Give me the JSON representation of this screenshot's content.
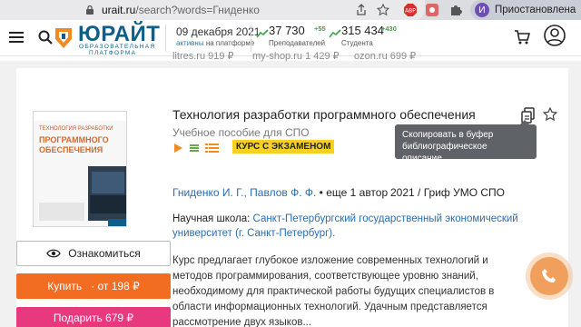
{
  "browser": {
    "url_host": "urait.ru",
    "url_path": "/search?words=Гниденко",
    "profile_initial": "И",
    "profile_label": "Приостановлена"
  },
  "header": {
    "logo_title": "ЮРАЙТ",
    "logo_subtitle_1": "ОБРАЗОВАТЕЛЬНАЯ",
    "logo_subtitle_2": "ПЛАТФОРМА",
    "date": "09 декабря 2021",
    "date_sub_active": "активны",
    "date_sub_rest": " на платформе",
    "teachers_count": "37 730",
    "teachers_plus": "+55",
    "teachers_label": "Преподавателей",
    "students_count": "315 434",
    "students_plus": "+430",
    "students_label": "Студента"
  },
  "strip": {
    "left": "litres.ru   919 ₽",
    "middle": "my-shop.ru   1 429 ₽",
    "right": "ozon.ru   699 ₽"
  },
  "book": {
    "title": "Технология разработки программного обеспечения",
    "subtitle": "Учебное пособие для СПО",
    "exam_badge": "КУРС С ЭКЗАМЕНОМ",
    "authors": "Гниденко И. Г., Павлов Ф. Ф.",
    "authors_more": " • еще 1 автор",
    "year_grif": "2021 / Гриф УМО СПО",
    "school_label": "Научная школа: ",
    "school_name_1": "Санкт-Петербургский государственный экономический",
    "school_name_2": "университет (г. Санкт-Петербург).",
    "description": "Курс предлагает глубокое изложение современных технологий и методов программирования, соответствующее уровню знаний, необходимому для практической работы будущих специалистов в области информационных технологий. Удачным представляется рассмотрение двух языков...",
    "cover_title_small": "ТЕХНОЛОГИЯ РАЗРАБОТКИ",
    "cover_title_big": "ПРОГРАММНОГО ОБЕСПЕЧЕНИЯ"
  },
  "actions": {
    "view_label": "Ознакомиться",
    "buy_label": "Купить",
    "buy_price": "· от 198 ₽",
    "gift_label": "Подарить 679 ₽"
  },
  "tooltip": {
    "line1": "Скопировать в буфер",
    "line2": "библиографическое описание"
  },
  "colors": {
    "brand_blue": "#0f5e88",
    "buy_orange": "#f26c21",
    "gift_pink": "#e8397e",
    "badge_yellow": "#f7d023",
    "link_blue": "#2b6cb0"
  }
}
